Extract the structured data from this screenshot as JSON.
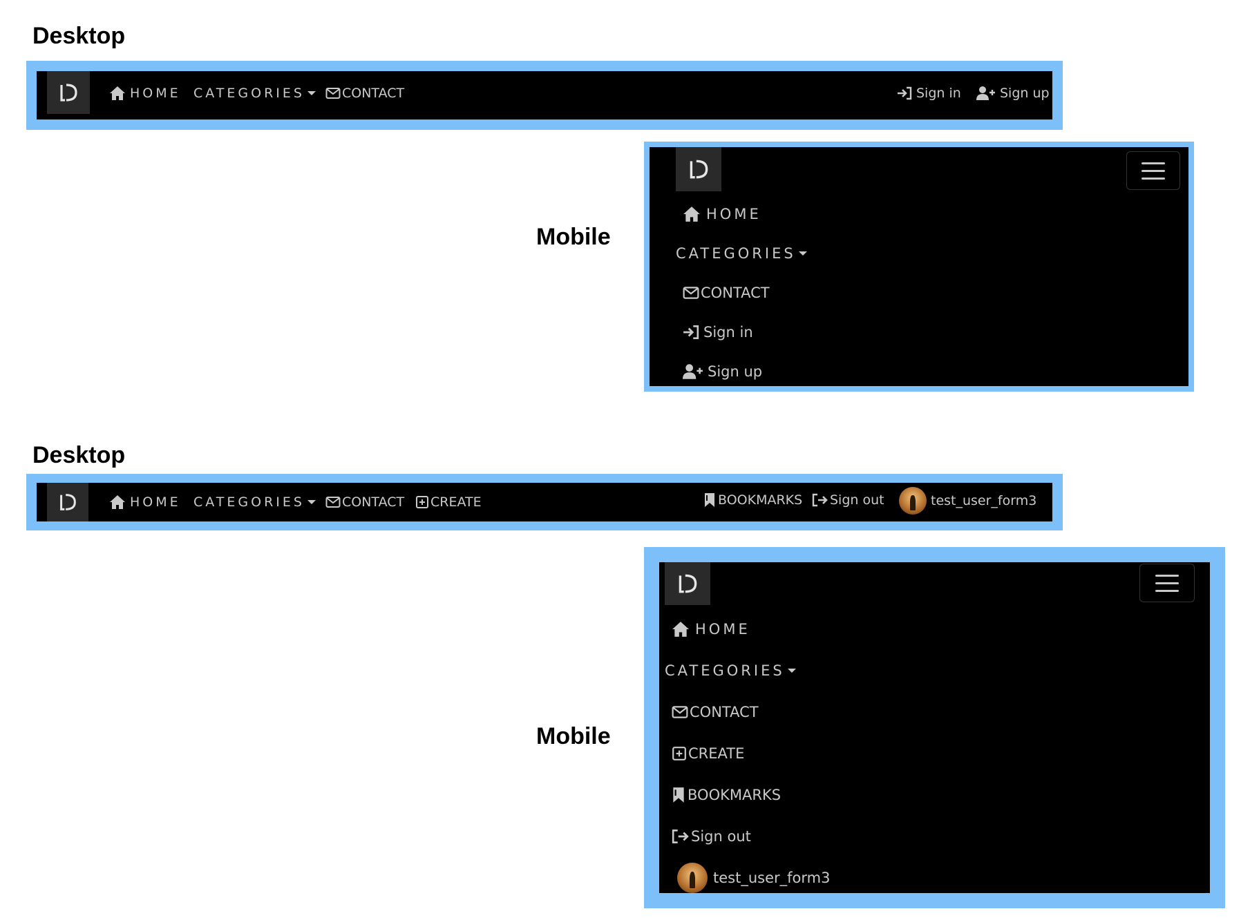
{
  "labels": {
    "desktop": "Desktop",
    "mobile": "Mobile"
  },
  "logo_icon": "ld-logo-icon",
  "guest_nav": {
    "home": "HOME",
    "categories": "CATEGORIES",
    "contact": "CONTACT",
    "sign_in": "Sign in",
    "sign_up": "Sign up"
  },
  "user_nav": {
    "home": "HOME",
    "categories": "CATEGORIES",
    "contact": "CONTACT",
    "create": "CREATE",
    "bookmarks": "BOOKMARKS",
    "sign_out": "Sign out",
    "username": "test_user_form3"
  },
  "colors": {
    "frame": "#7dbff8",
    "bar": "#000000",
    "nav_text": "#c9c9c9",
    "logo_bg": "#2a2a2a"
  }
}
